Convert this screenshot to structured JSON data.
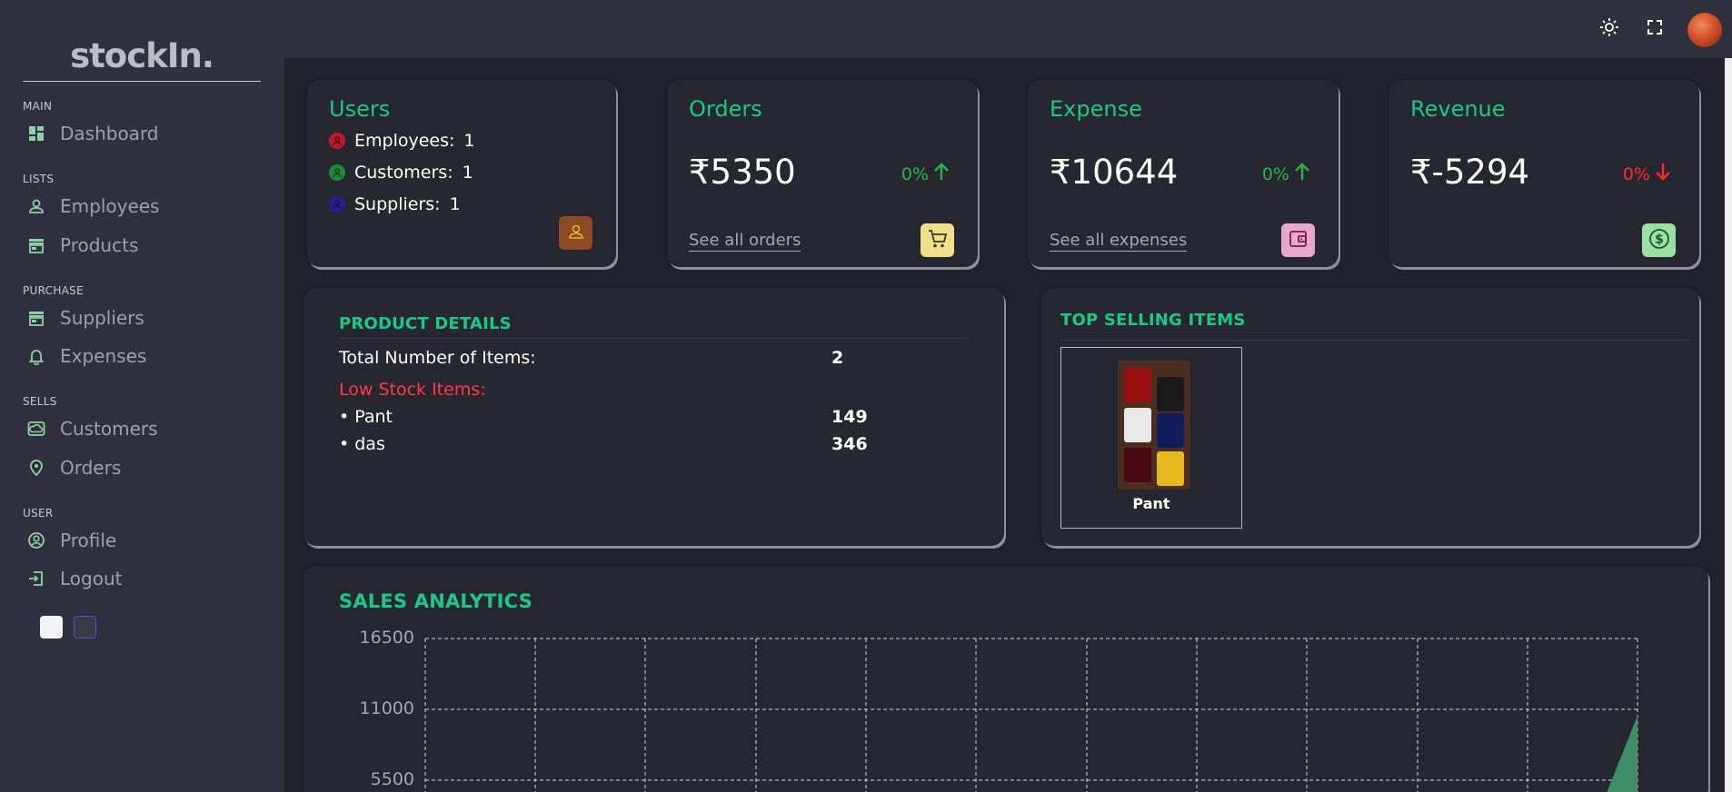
{
  "sidebar": {
    "logo": "stockIn.",
    "sections": [
      {
        "title": "MAIN",
        "items": [
          {
            "label": "Dashboard",
            "icon": "dashboard-icon"
          }
        ]
      },
      {
        "title": "LISTS",
        "items": [
          {
            "label": "Employees",
            "icon": "person-icon"
          },
          {
            "label": "Products",
            "icon": "store-icon"
          }
        ]
      },
      {
        "title": "PURCHASE",
        "items": [
          {
            "label": "Suppliers",
            "icon": "store-icon"
          },
          {
            "label": "Expenses",
            "icon": "bell-icon"
          }
        ]
      },
      {
        "title": "SELLS",
        "items": [
          {
            "label": "Customers",
            "icon": "cloud-icon"
          },
          {
            "label": "Orders",
            "icon": "location-icon"
          }
        ]
      },
      {
        "title": "USER",
        "items": [
          {
            "label": "Profile",
            "icon": "profile-icon"
          },
          {
            "label": "Logout",
            "icon": "logout-icon"
          }
        ]
      }
    ]
  },
  "users_card": {
    "title": "Users",
    "rows": [
      {
        "label": "Employees:",
        "value": "1",
        "color": "#c0182a"
      },
      {
        "label": "Customers:",
        "value": "1",
        "color": "#1f8a3a"
      },
      {
        "label": "Suppliers:",
        "value": "1",
        "color": "#2a1f8f"
      }
    ]
  },
  "orders_card": {
    "title": "Orders",
    "amount": "₹5350",
    "change": "0%",
    "direction": "up",
    "link": "See all orders"
  },
  "expense_card": {
    "title": "Expense",
    "amount": "₹10644",
    "change": "0%",
    "direction": "up",
    "link": "See all expenses"
  },
  "revenue_card": {
    "title": "Revenue",
    "amount": "₹-5294",
    "change": "0%",
    "direction": "down"
  },
  "product_details": {
    "title": "PRODUCT DETAILS",
    "total_label": "Total Number of Items:",
    "total_value": "2",
    "low_stock_label": "Low Stock Items:",
    "items": [
      {
        "name": "• Pant",
        "qty": "149"
      },
      {
        "name": "• das",
        "qty": "346"
      }
    ]
  },
  "top_selling": {
    "title": "TOP SELLING ITEMS",
    "items": [
      {
        "name": "Pant"
      }
    ]
  },
  "sales_analytics": {
    "title": "SALES ANALYTICS"
  },
  "chart_data": {
    "type": "area",
    "title": "SALES ANALYTICS",
    "y_ticks": [
      "16500",
      "11000",
      "5500"
    ],
    "ylim": [
      0,
      16500
    ],
    "grid": true
  }
}
